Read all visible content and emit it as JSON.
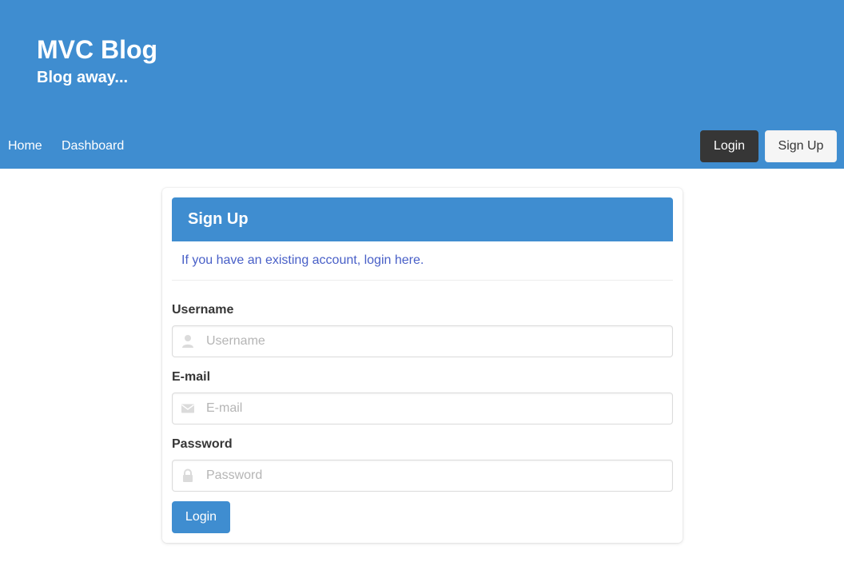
{
  "brand": {
    "title": "MVC Blog",
    "subtitle": "Blog away..."
  },
  "nav": {
    "links": [
      "Home",
      "Dashboard"
    ],
    "login_label": "Login",
    "signup_label": "Sign Up"
  },
  "card": {
    "title": "Sign Up",
    "note_prefix": "If you have an existing account, ",
    "note_link": "login here",
    "note_suffix": ".",
    "fields": [
      {
        "label": "Username",
        "placeholder": "Username",
        "value": "",
        "icon": "user-icon"
      },
      {
        "label": "E-mail",
        "placeholder": "E-mail",
        "value": "",
        "icon": "envelope-icon"
      },
      {
        "label": "Password",
        "placeholder": "Password",
        "value": "",
        "icon": "lock-icon"
      }
    ],
    "submit_label": "Login"
  },
  "colors": {
    "primary": "#3f8dd0",
    "dark": "#363636",
    "link": "#485fc7",
    "icon": "#dbdbdb"
  }
}
